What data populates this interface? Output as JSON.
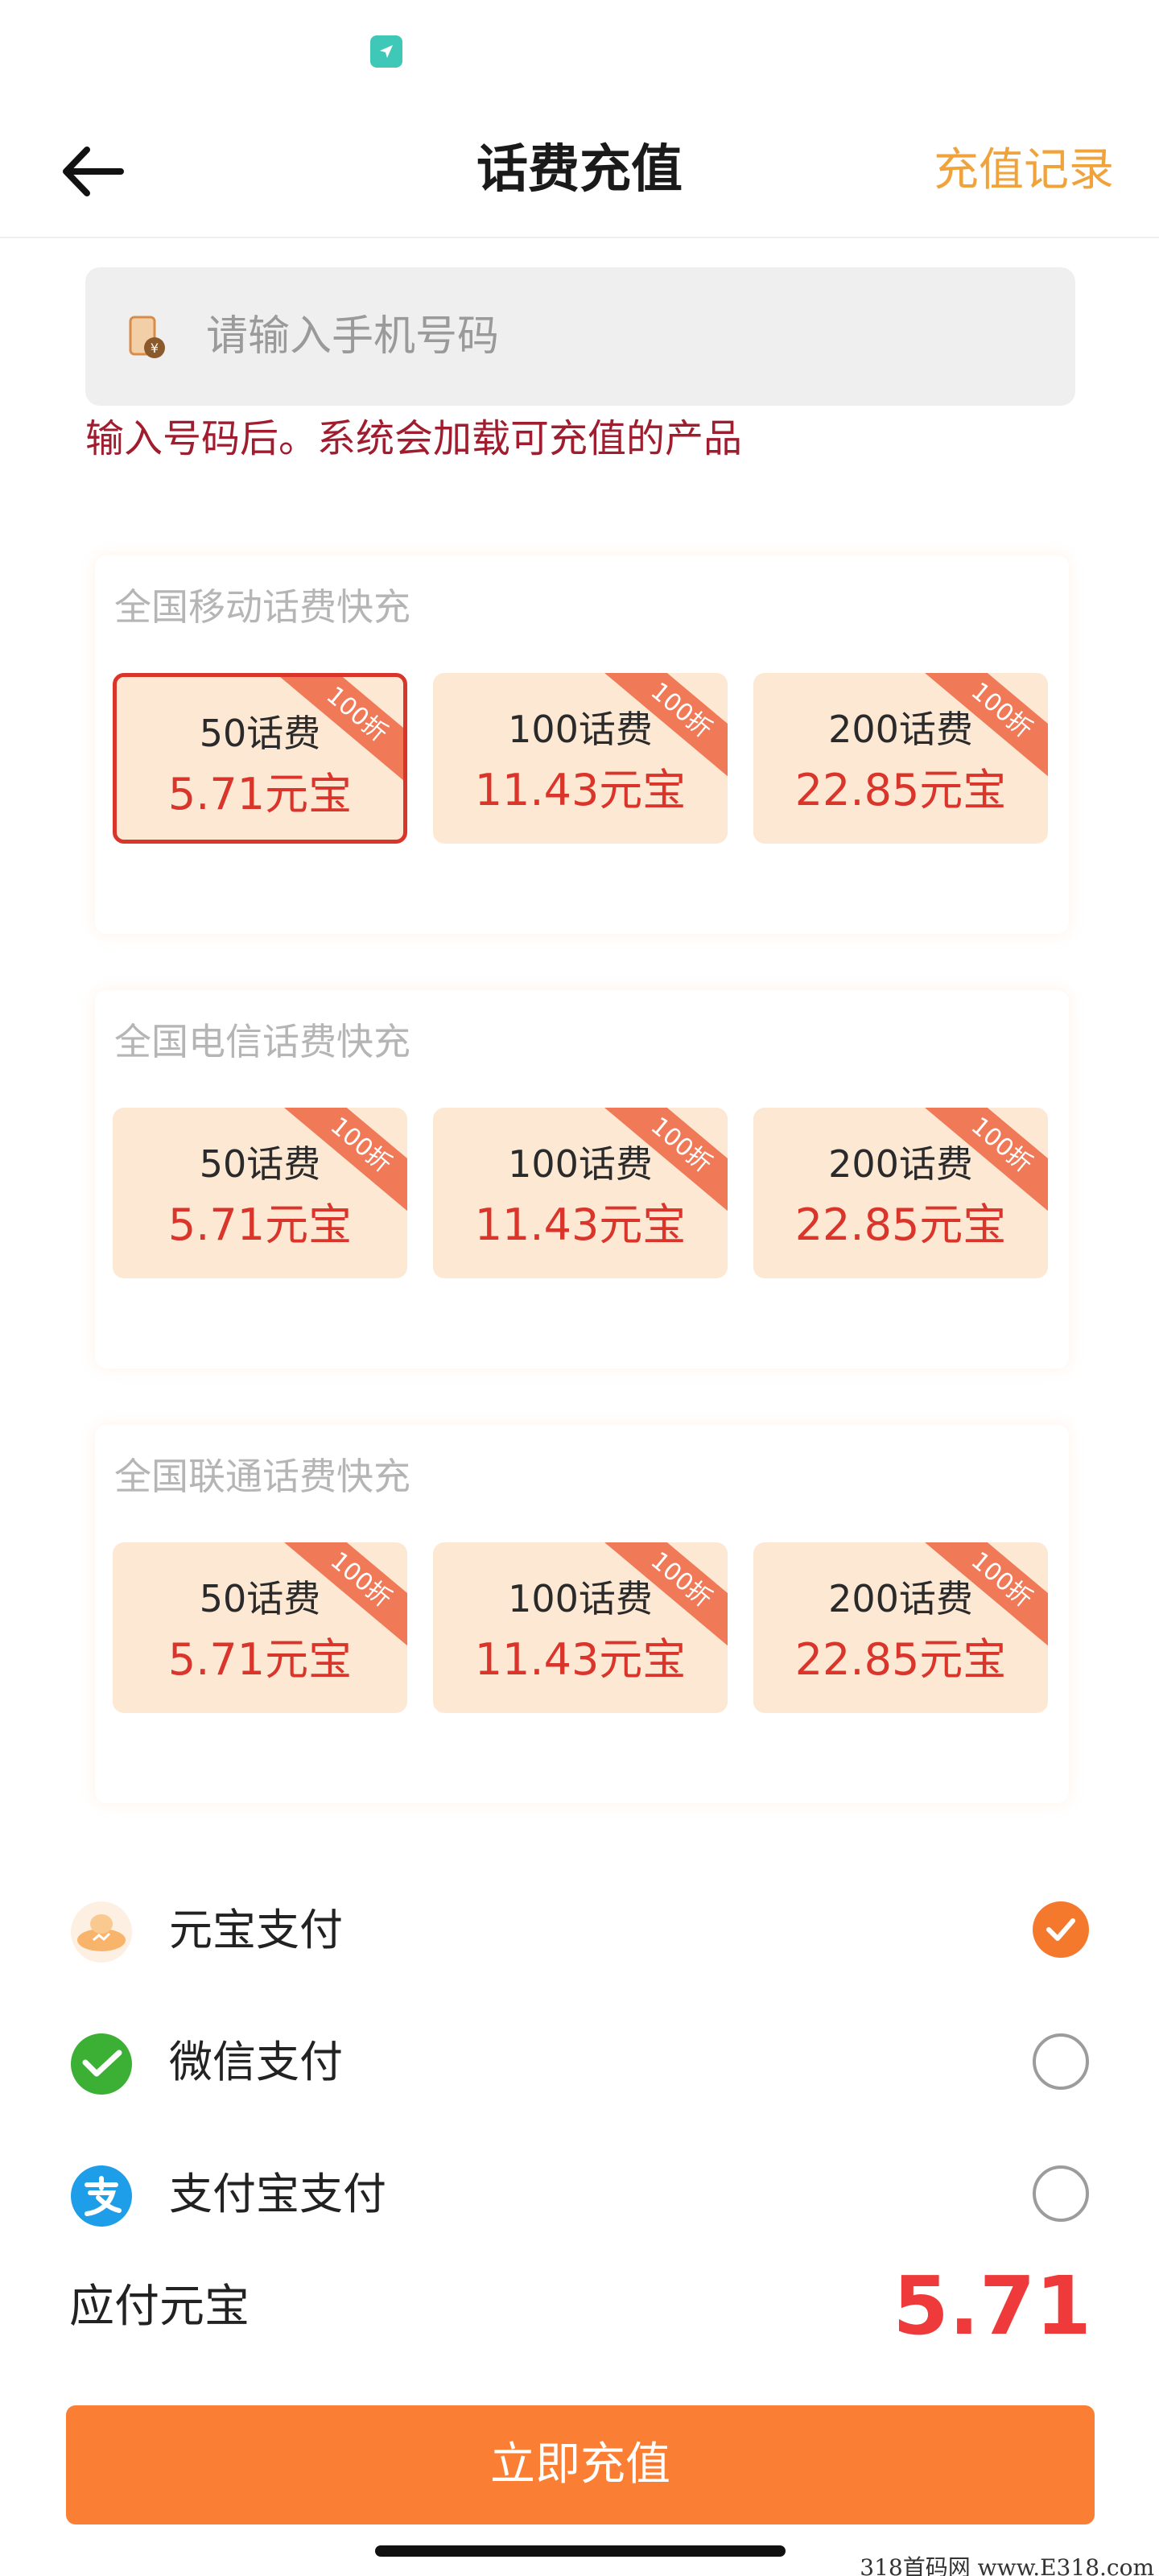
{
  "header": {
    "title": "话费充值",
    "history_label": "充值记录"
  },
  "phone": {
    "placeholder": "请输入手机号码",
    "hint": "输入号码后。系统会加载可充值的产品"
  },
  "sections": [
    {
      "title": "全国移动话费快充",
      "products": [
        {
          "face": "50话费",
          "price": "5.71元宝",
          "badge": "100折",
          "selected": true
        },
        {
          "face": "100话费",
          "price": "11.43元宝",
          "badge": "100折",
          "selected": false
        },
        {
          "face": "200话费",
          "price": "22.85元宝",
          "badge": "100折",
          "selected": false
        }
      ]
    },
    {
      "title": "全国电信话费快充",
      "products": [
        {
          "face": "50话费",
          "price": "5.71元宝",
          "badge": "100折",
          "selected": false
        },
        {
          "face": "100话费",
          "price": "11.43元宝",
          "badge": "100折",
          "selected": false
        },
        {
          "face": "200话费",
          "price": "22.85元宝",
          "badge": "100折",
          "selected": false
        }
      ]
    },
    {
      "title": "全国联通话费快充",
      "products": [
        {
          "face": "50话费",
          "price": "5.71元宝",
          "badge": "100折",
          "selected": false
        },
        {
          "face": "100话费",
          "price": "11.43元宝",
          "badge": "100折",
          "selected": false
        },
        {
          "face": "200话费",
          "price": "22.85元宝",
          "badge": "100折",
          "selected": false
        }
      ]
    }
  ],
  "payment": {
    "methods": [
      {
        "label": "元宝支付",
        "icon": "yuanbao-icon",
        "checked": true
      },
      {
        "label": "微信支付",
        "icon": "wechat-icon",
        "checked": false
      },
      {
        "label": "支付宝支付",
        "icon": "alipay-icon",
        "checked": false
      }
    ],
    "total_label": "应付元宝",
    "total_value": "5.71"
  },
  "submit_label": "立即充值",
  "watermark": "318首码网 www.E318.com",
  "colors": {
    "accent": "#fa7f35",
    "price_red": "#d9352b",
    "card_bg": "#fde8d4",
    "history_orange": "#f0a23b",
    "hint_red": "#9f1d2e",
    "wechat_green": "#3cb034",
    "alipay_blue": "#1e9ee8"
  }
}
